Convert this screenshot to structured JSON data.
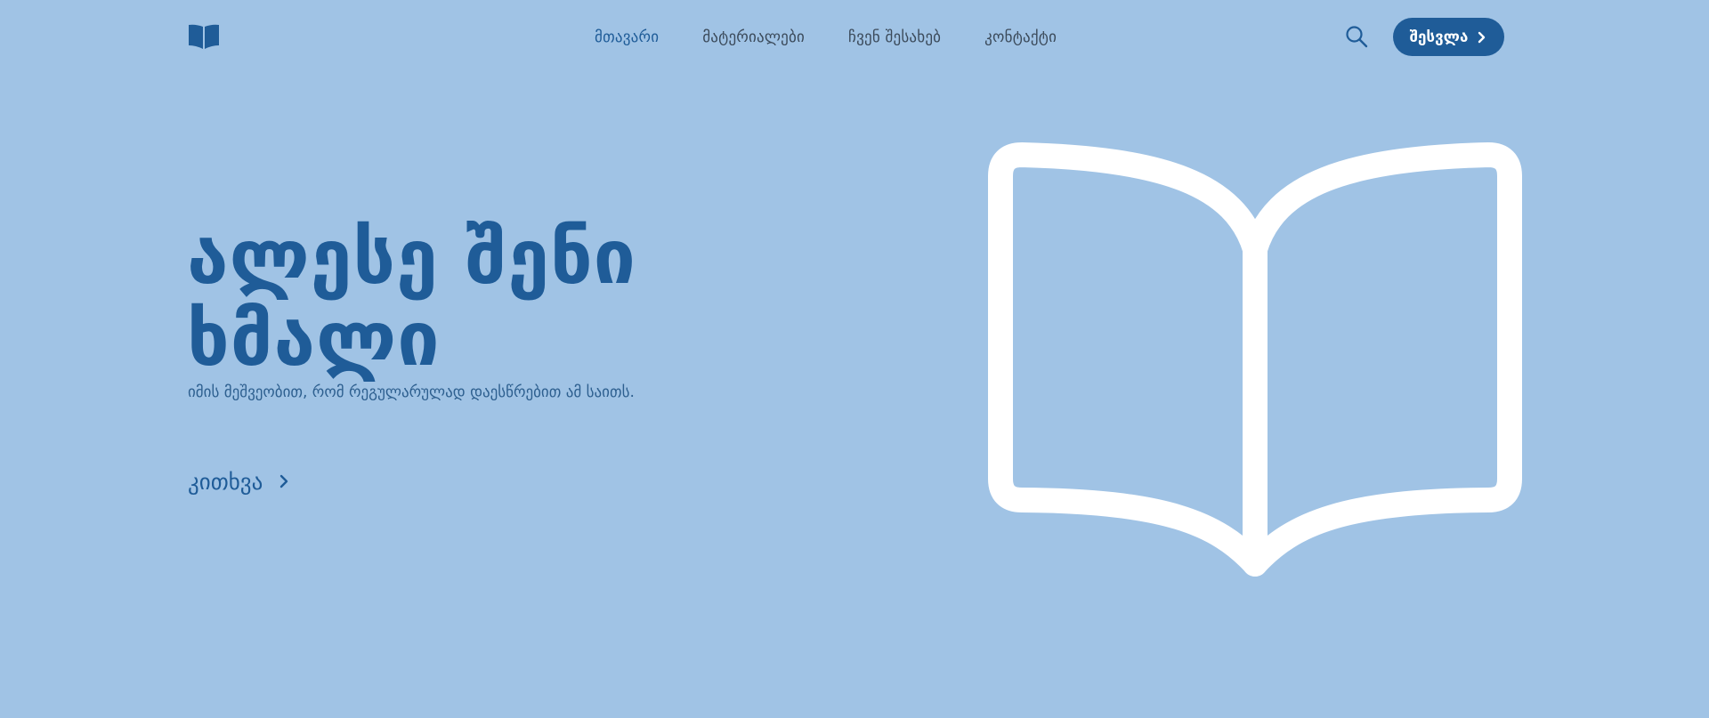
{
  "header": {
    "logo_icon": "book-icon",
    "nav": [
      {
        "label": "მთავარი",
        "active": true
      },
      {
        "label": "მატერიალები",
        "active": false
      },
      {
        "label": "ჩვენ შესახებ",
        "active": false
      },
      {
        "label": "კონტაქტი",
        "active": false
      }
    ],
    "search_icon": "search-icon",
    "login_label": "შესვლა"
  },
  "hero": {
    "title_line1": "ალესე შენი",
    "title_line2": "ხმალი",
    "subtitle": "იმის მეშვეობით, რომ რეგულარულად დაესწრებით ამ საითს.",
    "cta_label": "კითხვა",
    "illustration_icon": "open-book-icon"
  },
  "colors": {
    "background": "#a0c3e5",
    "primary": "#1f5c98",
    "nav_text": "#3b4a5a",
    "illustration": "#ffffff"
  }
}
